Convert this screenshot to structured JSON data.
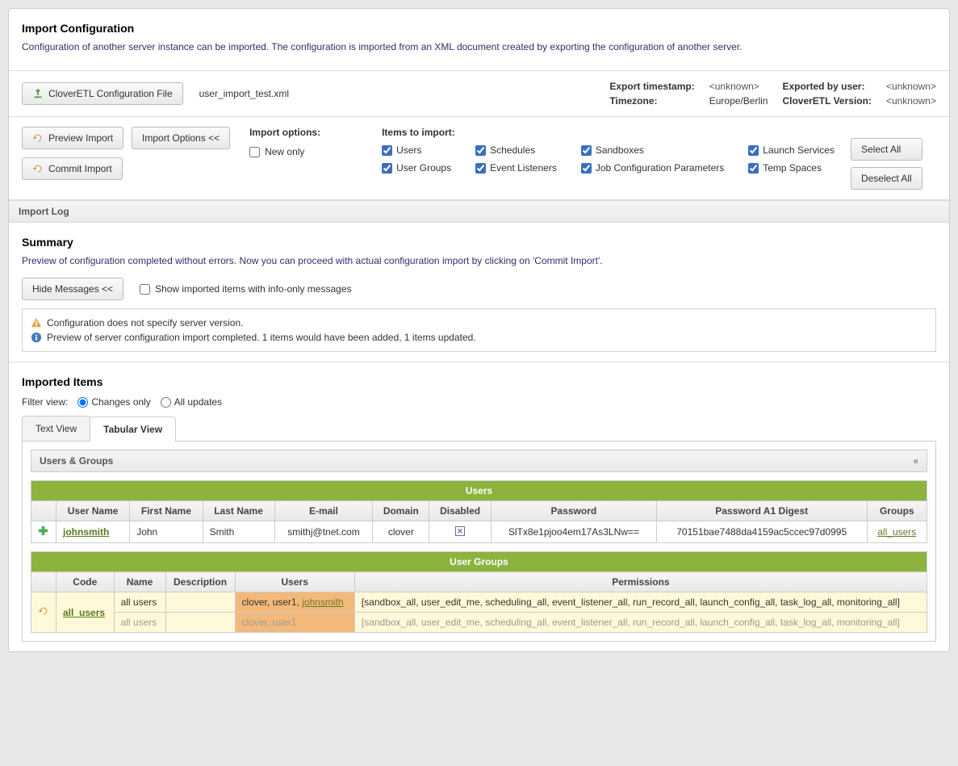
{
  "header": {
    "title": "Import Configuration",
    "desc": "Configuration of another server instance can be imported. The configuration is imported from an XML document created by exporting the configuration of another server."
  },
  "file": {
    "button": "CloverETL Configuration File",
    "filename": "user_import_test.xml",
    "meta": {
      "exportTimestampLabel": "Export timestamp:",
      "exportTimestamp": "<unknown>",
      "exportedByLabel": "Exported by user:",
      "exportedBy": "<unknown>",
      "timezoneLabel": "Timezone:",
      "timezone": "Europe/Berlin",
      "versionLabel": "CloverETL Version:",
      "version": "<unknown>"
    }
  },
  "actions": {
    "preview": "Preview Import",
    "importOptions": "Import Options <<",
    "commit": "Commit Import",
    "importOptionsHeader": "Import options:",
    "newOnly": "New only",
    "itemsHeader": "Items to import:",
    "items": {
      "users": "Users",
      "schedules": "Schedules",
      "sandboxes": "Sandboxes",
      "launchServices": "Launch Services",
      "userGroups": "User Groups",
      "eventListeners": "Event Listeners",
      "jobConfig": "Job Configuration Parameters",
      "tempSpaces": "Temp Spaces"
    },
    "selectAll": "Select All",
    "deselectAll": "Deselect All"
  },
  "importLog": {
    "header": "Import Log"
  },
  "summary": {
    "title": "Summary",
    "desc": "Preview of configuration completed without errors. Now you can proceed with actual configuration import by clicking on 'Commit Import'.",
    "hideMessages": "Hide Messages <<",
    "showInfoOnly": "Show imported items with info-only messages",
    "msgWarn": "Configuration does not specify server version.",
    "msgInfo": "Preview of server configuration import completed. 1 items would have been added, 1 items updated."
  },
  "imported": {
    "title": "Imported Items",
    "filterLabel": "Filter view:",
    "changesOnly": "Changes only",
    "allUpdates": "All updates",
    "tabText": "Text View",
    "tabTabular": "Tabular View",
    "groupHeader": "Users & Groups",
    "usersTable": {
      "title": "Users",
      "cols": [
        "",
        "User Name",
        "First Name",
        "Last Name",
        "E-mail",
        "Domain",
        "Disabled",
        "Password",
        "Password A1 Digest",
        "Groups"
      ],
      "row": {
        "username": "johnsmith",
        "first": "John",
        "last": "Smith",
        "email": "smithj@tnet.com",
        "domain": "clover",
        "password": "SlTx8e1pjoo4em17As3LNw==",
        "digest": "70151bae7488da4159ac5ccec97d0995",
        "groups": "all_users"
      }
    },
    "groupsTable": {
      "title": "User Groups",
      "cols": [
        "",
        "Code",
        "Name",
        "Description",
        "Users",
        "Permissions"
      ],
      "row": {
        "code": "all_users",
        "nameNew": "all users",
        "nameOld": "all users",
        "usersNew": "clover, user1, ",
        "usersNewLink": "johnsmith",
        "usersOld": "clover, user1",
        "permsNew": "[sandbox_all, user_edit_me, scheduling_all, event_listener_all, run_record_all, launch_config_all, task_log_all, monitoring_all]",
        "permsOld": "[sandbox_all, user_edit_me, scheduling_all, event_listener_all, run_record_all, launch_config_all, task_log_all, monitoring_all]"
      }
    }
  }
}
